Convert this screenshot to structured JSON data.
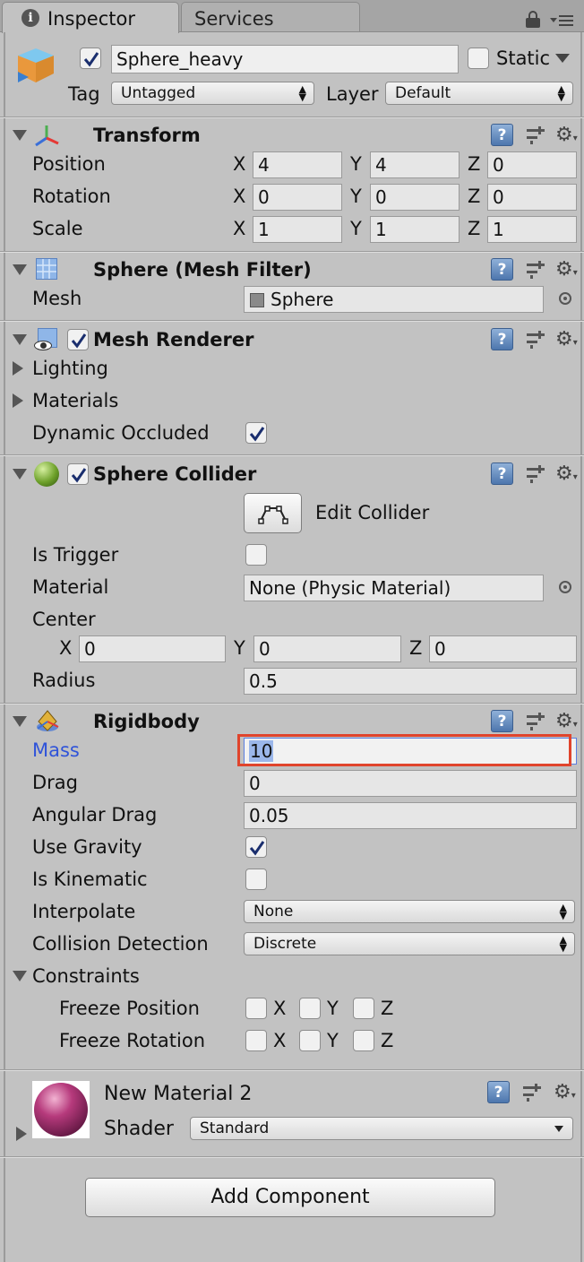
{
  "tabs": [
    {
      "label": "Inspector",
      "active": true
    },
    {
      "label": "Services",
      "active": false
    }
  ],
  "gameobject": {
    "active": true,
    "name": "Sphere_heavy",
    "static_label": "Static",
    "static_checked": false,
    "tag_label": "Tag",
    "tag_value": "Untagged",
    "layer_label": "Layer",
    "layer_value": "Default"
  },
  "transform": {
    "title": "Transform",
    "rows": [
      {
        "label": "Position",
        "x": "4",
        "y": "4",
        "z": "0"
      },
      {
        "label": "Rotation",
        "x": "0",
        "y": "0",
        "z": "0"
      },
      {
        "label": "Scale",
        "x": "1",
        "y": "1",
        "z": "1"
      }
    ],
    "axis": {
      "x": "X",
      "y": "Y",
      "z": "Z"
    }
  },
  "mesh_filter": {
    "title": "Sphere (Mesh Filter)",
    "mesh_label": "Mesh",
    "mesh_value": "Sphere"
  },
  "mesh_renderer": {
    "title": "Mesh Renderer",
    "enabled": true,
    "lighting": "Lighting",
    "materials": "Materials",
    "dynamic_occluded_label": "Dynamic Occluded",
    "dynamic_occluded": true
  },
  "sphere_collider": {
    "title": "Sphere Collider",
    "enabled": true,
    "edit_collider": "Edit Collider",
    "is_trigger_label": "Is Trigger",
    "is_trigger": false,
    "material_label": "Material",
    "material_value": "None (Physic Material)",
    "center_label": "Center",
    "center": {
      "x": "0",
      "y": "0",
      "z": "0"
    },
    "radius_label": "Radius",
    "radius_value": "0.5"
  },
  "rigidbody": {
    "title": "Rigidbody",
    "mass_label": "Mass",
    "mass_value": "10",
    "drag_label": "Drag",
    "drag_value": "0",
    "angular_drag_label": "Angular Drag",
    "angular_drag_value": "0.05",
    "use_gravity_label": "Use Gravity",
    "use_gravity": true,
    "is_kinematic_label": "Is Kinematic",
    "is_kinematic": false,
    "interpolate_label": "Interpolate",
    "interpolate_value": "None",
    "collision_label": "Collision Detection",
    "collision_value": "Discrete",
    "constraints_label": "Constraints",
    "freeze_position_label": "Freeze Position",
    "freeze_rotation_label": "Freeze Rotation"
  },
  "material": {
    "name": "New Material 2",
    "shader_label": "Shader",
    "shader_value": "Standard"
  },
  "add_component": "Add Component",
  "colors": {
    "highlight_border": "#e0442c",
    "mass_label": "#2f53d9",
    "selection": "#9bb7ea"
  },
  "icons": [
    "gameobject-cube-icon",
    "transform-axes-icon",
    "mesh-filter-icon",
    "mesh-renderer-icon",
    "sphere-collider-icon",
    "rigidbody-icon",
    "help-book-icon",
    "preset-icon",
    "gear-icon",
    "lock-icon",
    "menu-icon",
    "object-picker-icon",
    "edit-collider-icon",
    "material-sphere-icon"
  ]
}
